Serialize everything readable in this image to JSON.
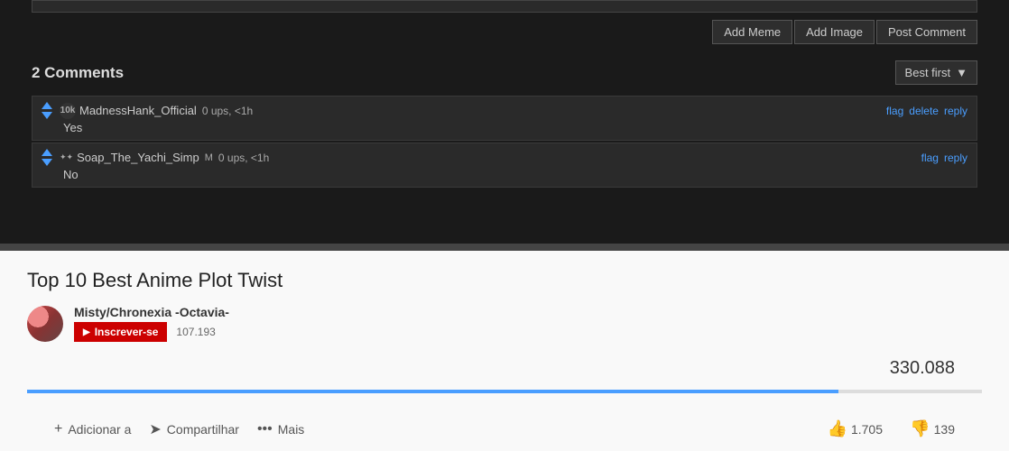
{
  "comment_input": {
    "placeholder": ""
  },
  "toolbar": {
    "add_meme_label": "Add Meme",
    "add_image_label": "Add Image",
    "post_comment_label": "Post Comment"
  },
  "comments_header": {
    "count_label": "2 Comments",
    "sort_label": "Best first",
    "sort_arrow": "▼"
  },
  "comments": [
    {
      "username": "MadnessHank_Official",
      "badge": "10k",
      "moderator": "",
      "stats": "0 ups, <1h",
      "text": "Yes",
      "actions": [
        "flag",
        "delete",
        "reply"
      ]
    },
    {
      "username": "Soap_The_Yachi_Simp",
      "badge": "✦",
      "moderator": "M",
      "stats": "0 ups, <1h",
      "text": "No",
      "actions": [
        "flag",
        "reply"
      ]
    }
  ],
  "video": {
    "title": "Top 10 Best Anime Plot Twist",
    "channel_name": "Misty/Chronexia -Octavia-",
    "subscribe_label": "Inscrever-se",
    "subscriber_count": "107.193",
    "view_count": "330.088",
    "progress_percent": 85,
    "like_count": "1.705",
    "dislike_count": "139"
  },
  "video_actions": [
    {
      "label": "Adicionar a",
      "icon": "+"
    },
    {
      "label": "Compartilhar",
      "icon": "➤"
    },
    {
      "label": "Mais",
      "icon": "•••"
    }
  ]
}
